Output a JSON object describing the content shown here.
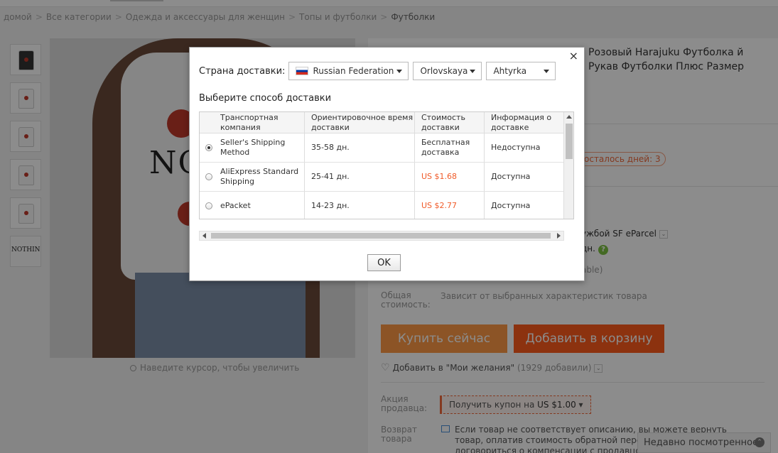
{
  "breadcrumb": [
    "домой",
    "Все категории",
    "Одежда и аксессуары для женщин",
    "Топы и футболки",
    "Футболки"
  ],
  "breadcrumb_separator": ">",
  "gallery": {
    "zoom_hint": "Наведите курсор, чтобы увеличить",
    "main_image_text": "NO",
    "last_thumb_text": "NOTHING"
  },
  "product": {
    "title": "Розовый Harajuku Футболка й Рукав Футболки Плюс Размер",
    "days_left": "осталось дней: 3",
    "shipping_service": "ужбой SF eParcel",
    "shipping_days": "дн.",
    "availability_trail": "able)",
    "total_label": "Общая стоимость:",
    "total_value": "Зависит от выбранных характеристик товара",
    "buy_now": "Купить сейчас",
    "add_to_cart": "Добавить в корзину",
    "wishlist": "Добавить в \"Мои желания\"",
    "wishlist_count": "(1929 добавили)",
    "seller_promo_label": "Акция продавца:",
    "coupon_text": "Получить купон на",
    "coupon_amount": "US $1.00",
    "return_label": "Возврат товара",
    "return_text": "Если товар не соответствует описанию, вы можете вернуть товар, оплатив стоимость обратной пересылки, или договориться о компенсации с продавцом.",
    "recently_viewed": "Недавно посмотренное"
  },
  "dialog": {
    "close": "×",
    "country_label": "Страна доставки:",
    "country": "Russian Federation",
    "region": "Orlovskaya",
    "city": "Ahtyrka",
    "method_title": "Выберите способ доставки",
    "headers": [
      "Транспортная компания",
      "Ориентировочное время доставки",
      "Стоимость доставки",
      "Информация о доставке"
    ],
    "rows": [
      {
        "company": "Seller's Shipping Method",
        "time": "35-58 дн.",
        "cost": "Бесплатная доставка",
        "info": "Недоступна",
        "selected": true
      },
      {
        "company": "AliExpress Standard Shipping",
        "time": "25-41 дн.",
        "cost": "US $1.68",
        "info": "Доступна",
        "selected": false
      },
      {
        "company": "ePacket",
        "time": "14-23 дн.",
        "cost": "US $2.77",
        "info": "Доступна",
        "selected": false
      }
    ],
    "ok": "OK"
  },
  "colors": {
    "accent_orange": "#ff5c1c",
    "buy_orange": "#ff9a46",
    "price_red": "#f05a28",
    "overlay": "rgba(0,0,0,0.45)"
  },
  "icons": [
    "close-icon",
    "chevron-down-icon",
    "radio-icon",
    "heart-icon",
    "magnifier-icon",
    "question-icon",
    "return-icon",
    "chevron-up-icon",
    "flag-icon"
  ]
}
